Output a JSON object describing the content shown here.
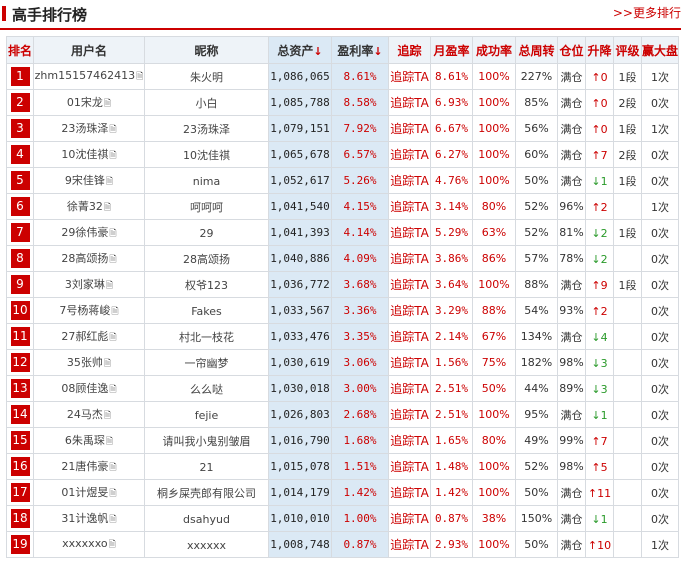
{
  "header": {
    "title": "高手排行榜",
    "more": ">>更多排行"
  },
  "columns": [
    "排名",
    "用户名",
    "昵称",
    "总资产",
    "盈利率",
    "追踪",
    "月盈率",
    "成功率",
    "总周转",
    "仓位",
    "升降",
    "评级",
    "赢大盘"
  ],
  "sort_arrow": "↓",
  "rows": [
    {
      "rank": "1",
      "user": "zhm15157462413",
      "nick": "朱火明",
      "asset": "1,086,065",
      "rate": "8.61%",
      "track": "追踪TA",
      "monthly": "8.61%",
      "success": "100%",
      "turnover": "227%",
      "position": "满仓",
      "trend": "up",
      "change": "0",
      "grade": "1段",
      "beat": "1次"
    },
    {
      "rank": "2",
      "user": "01宋龙",
      "nick": "小白",
      "asset": "1,085,788",
      "rate": "8.58%",
      "track": "追踪TA",
      "monthly": "6.93%",
      "success": "100%",
      "turnover": "85%",
      "position": "满仓",
      "trend": "up",
      "change": "0",
      "grade": "2段",
      "beat": "0次"
    },
    {
      "rank": "3",
      "user": "23汤珠泽",
      "nick": "23汤珠泽",
      "asset": "1,079,151",
      "rate": "7.92%",
      "track": "追踪TA",
      "monthly": "6.67%",
      "success": "100%",
      "turnover": "56%",
      "position": "满仓",
      "trend": "up",
      "change": "0",
      "grade": "1段",
      "beat": "1次"
    },
    {
      "rank": "4",
      "user": "10沈佳祺",
      "nick": "10沈佳祺",
      "asset": "1,065,678",
      "rate": "6.57%",
      "track": "追踪TA",
      "monthly": "6.27%",
      "success": "100%",
      "turnover": "60%",
      "position": "满仓",
      "trend": "up",
      "change": "7",
      "grade": "2段",
      "beat": "0次"
    },
    {
      "rank": "5",
      "user": "9宋佳锋",
      "nick": "nima",
      "asset": "1,052,617",
      "rate": "5.26%",
      "track": "追踪TA",
      "monthly": "4.76%",
      "success": "100%",
      "turnover": "50%",
      "position": "满仓",
      "trend": "down",
      "change": "1",
      "grade": "1段",
      "beat": "0次"
    },
    {
      "rank": "6",
      "user": "徐菁32",
      "nick": "呵呵呵",
      "asset": "1,041,540",
      "rate": "4.15%",
      "track": "追踪TA",
      "monthly": "3.14%",
      "success": "80%",
      "turnover": "52%",
      "position": "96%",
      "trend": "up",
      "change": "2",
      "grade": "",
      "beat": "1次"
    },
    {
      "rank": "7",
      "user": "29徐伟豪",
      "nick": "29",
      "asset": "1,041,393",
      "rate": "4.14%",
      "track": "追踪TA",
      "monthly": "5.29%",
      "success": "63%",
      "turnover": "52%",
      "position": "81%",
      "trend": "down",
      "change": "2",
      "grade": "1段",
      "beat": "0次"
    },
    {
      "rank": "8",
      "user": "28高颂扬",
      "nick": "28高颂扬",
      "asset": "1,040,886",
      "rate": "4.09%",
      "track": "追踪TA",
      "monthly": "3.86%",
      "success": "86%",
      "turnover": "57%",
      "position": "78%",
      "trend": "down",
      "change": "2",
      "grade": "",
      "beat": "0次"
    },
    {
      "rank": "9",
      "user": "3刘家琳",
      "nick": "权爷123",
      "asset": "1,036,772",
      "rate": "3.68%",
      "track": "追踪TA",
      "monthly": "3.64%",
      "success": "100%",
      "turnover": "88%",
      "position": "满仓",
      "trend": "up",
      "change": "9",
      "grade": "1段",
      "beat": "0次"
    },
    {
      "rank": "10",
      "user": "7号杨蒋峻",
      "nick": "Fakes",
      "asset": "1,033,567",
      "rate": "3.36%",
      "track": "追踪TA",
      "monthly": "3.29%",
      "success": "88%",
      "turnover": "54%",
      "position": "93%",
      "trend": "up",
      "change": "2",
      "grade": "",
      "beat": "0次"
    },
    {
      "rank": "11",
      "user": "27郝红彪",
      "nick": "村北一枝花",
      "asset": "1,033,476",
      "rate": "3.35%",
      "track": "追踪TA",
      "monthly": "2.14%",
      "success": "67%",
      "turnover": "134%",
      "position": "满仓",
      "trend": "down",
      "change": "4",
      "grade": "",
      "beat": "0次"
    },
    {
      "rank": "12",
      "user": "35张帅",
      "nick": "一帘幽梦",
      "asset": "1,030,619",
      "rate": "3.06%",
      "track": "追踪TA",
      "monthly": "1.56%",
      "success": "75%",
      "turnover": "182%",
      "position": "98%",
      "trend": "down",
      "change": "3",
      "grade": "",
      "beat": "0次"
    },
    {
      "rank": "13",
      "user": "08顾佳逸",
      "nick": "么么哒",
      "asset": "1,030,018",
      "rate": "3.00%",
      "track": "追踪TA",
      "monthly": "2.51%",
      "success": "50%",
      "turnover": "44%",
      "position": "89%",
      "trend": "down",
      "change": "3",
      "grade": "",
      "beat": "0次"
    },
    {
      "rank": "14",
      "user": "24马杰",
      "nick": "fejie",
      "asset": "1,026,803",
      "rate": "2.68%",
      "track": "追踪TA",
      "monthly": "2.51%",
      "success": "100%",
      "turnover": "95%",
      "position": "满仓",
      "trend": "down",
      "change": "1",
      "grade": "",
      "beat": "0次"
    },
    {
      "rank": "15",
      "user": "6朱禹琛",
      "nick": "请叫我小鬼别皱眉",
      "asset": "1,016,790",
      "rate": "1.68%",
      "track": "追踪TA",
      "monthly": "1.65%",
      "success": "80%",
      "turnover": "49%",
      "position": "99%",
      "trend": "up",
      "change": "7",
      "grade": "",
      "beat": "0次"
    },
    {
      "rank": "16",
      "user": "21唐伟豪",
      "nick": "21",
      "asset": "1,015,078",
      "rate": "1.51%",
      "track": "追踪TA",
      "monthly": "1.48%",
      "success": "100%",
      "turnover": "52%",
      "position": "98%",
      "trend": "up",
      "change": "5",
      "grade": "",
      "beat": "0次"
    },
    {
      "rank": "17",
      "user": "01计煜旻",
      "nick": "桐乡屎壳郎有限公司",
      "asset": "1,014,179",
      "rate": "1.42%",
      "track": "追踪TA",
      "monthly": "1.42%",
      "success": "100%",
      "turnover": "50%",
      "position": "满仓",
      "trend": "up",
      "change": "11",
      "grade": "",
      "beat": "0次"
    },
    {
      "rank": "18",
      "user": "31计逸帆",
      "nick": "dsahyud",
      "asset": "1,010,010",
      "rate": "1.00%",
      "track": "追踪TA",
      "monthly": "0.87%",
      "success": "38%",
      "turnover": "150%",
      "position": "满仓",
      "trend": "down",
      "change": "1",
      "grade": "",
      "beat": "0次"
    },
    {
      "rank": "19",
      "user": "xxxxxxo",
      "nick": "xxxxxx",
      "asset": "1,008,748",
      "rate": "0.87%",
      "track": "追踪TA",
      "monthly": "2.93%",
      "success": "100%",
      "turnover": "50%",
      "position": "满仓",
      "trend": "up",
      "change": "10",
      "grade": "",
      "beat": "1次"
    }
  ],
  "colors": {
    "accent": "#cc0000",
    "up": "#cc0000",
    "down": "#2a9a2a",
    "header_bg": "#eef3f8",
    "highlight_col": "#dbe9f5"
  }
}
